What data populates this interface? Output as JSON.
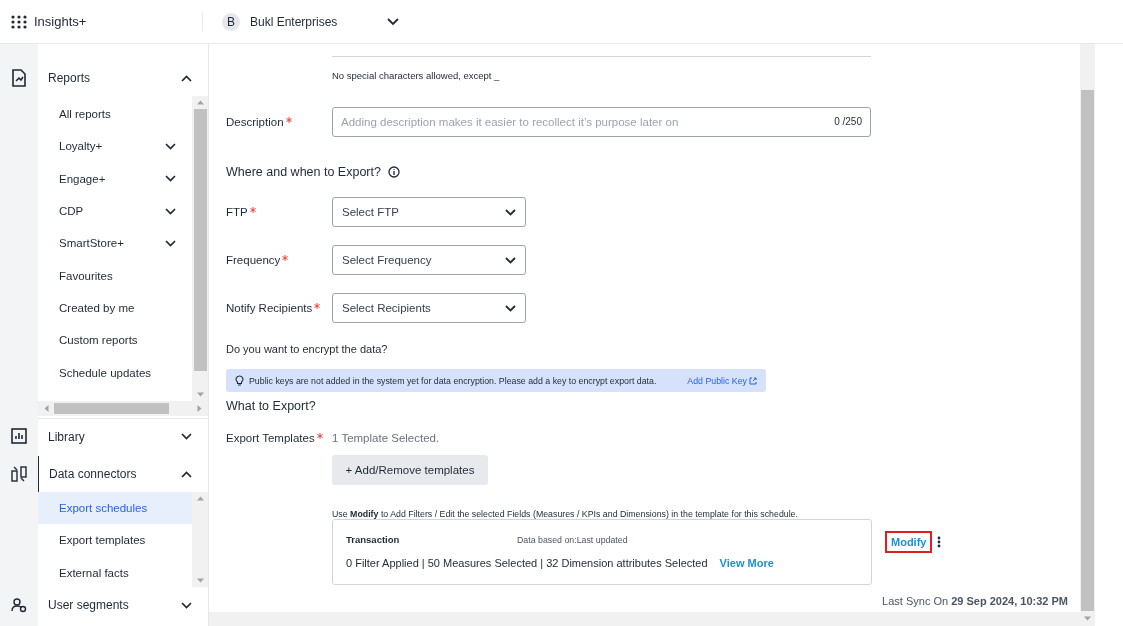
{
  "app": {
    "name": "Insights+"
  },
  "org": {
    "initial": "B",
    "name": "Bukl Enterprises"
  },
  "sidebar": {
    "sections": [
      {
        "label": "Reports",
        "expanded": true,
        "items": [
          {
            "label": "All reports",
            "expandable": false,
            "selected": false
          },
          {
            "label": "Loyalty+",
            "expandable": true,
            "selected": false
          },
          {
            "label": "Engage+",
            "expandable": true,
            "selected": false
          },
          {
            "label": "CDP",
            "expandable": true,
            "selected": false
          },
          {
            "label": "SmartStore+",
            "expandable": true,
            "selected": false
          },
          {
            "label": "Favourites",
            "expandable": false,
            "selected": false
          },
          {
            "label": "Created by me",
            "expandable": false,
            "selected": false
          },
          {
            "label": "Custom reports",
            "expandable": false,
            "selected": false
          },
          {
            "label": "Schedule updates",
            "expandable": false,
            "selected": false
          }
        ]
      },
      {
        "label": "Library",
        "expanded": false
      },
      {
        "label": "Data connectors",
        "expanded": true,
        "items": [
          {
            "label": "Export schedules",
            "expandable": false,
            "selected": true
          },
          {
            "label": "Export templates",
            "expandable": false,
            "selected": false
          },
          {
            "label": "External facts",
            "expandable": false,
            "selected": false
          }
        ]
      },
      {
        "label": "User segments",
        "expanded": false
      }
    ]
  },
  "form": {
    "name_hint": "No special characters allowed, except _",
    "description": {
      "label": "Description",
      "required": true,
      "placeholder": "Adding description makes it easier to recollect it’s purpose later on",
      "counter": "0 /250"
    },
    "where_heading": "Where and when to Export?",
    "selects": [
      {
        "label": "FTP",
        "required": true,
        "placeholder": "Select FTP"
      },
      {
        "label": "Frequency",
        "required": true,
        "placeholder": "Select Frequency"
      },
      {
        "label": "Notify Recipients",
        "required": true,
        "placeholder": "Select Recipients"
      }
    ],
    "encrypt_question": "Do you want to encrypt the data?",
    "alert": {
      "text": "Public keys are not added in the system yet for data encryption. Please add a key to encrypt export data.",
      "link": "Add Public Key"
    },
    "what_heading": "What to Export?",
    "templates": {
      "label": "Export Templates",
      "required": true,
      "summary": "1 Template Selected.",
      "button": "+ Add/Remove templates"
    },
    "note": "Use **Modify** to Add Filters / Edit the selected Fields (Measures / KPIs and Dimensions) in the template for this schedule.",
    "card": {
      "title": "Transaction",
      "basis": "Data based on:Last updated",
      "details": "0 Filter Applied | 50 Measures Selected | 32 Dimension attributes Selected",
      "link": "View More"
    },
    "modify": {
      "label": "Modify",
      "highlighted": true
    },
    "last_sync": "Last Sync On **29 Sep 2024, 10:32 PM**"
  }
}
